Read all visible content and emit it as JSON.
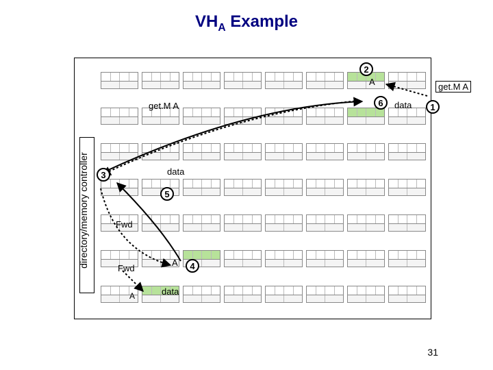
{
  "title_main": "VH",
  "title_sub": "A",
  "title_tail": " Example",
  "sidebar_label": "directory/memory controller",
  "labels": {
    "getM_A_top": "get.M A",
    "getM_A_right": "get.M A",
    "data1": "data",
    "data2": "data",
    "data3": "data",
    "fwd1": "Fwd",
    "fwd2": "Fwd",
    "A1": "A",
    "A2": "A",
    "A3": "A"
  },
  "steps": {
    "s1": "1",
    "s2": "2",
    "s3": "3",
    "s4": "4",
    "s5": "5",
    "s6": "6"
  },
  "page_number": "31",
  "chart_data": {
    "type": "diagram",
    "title": "VH_A Example",
    "grid": {
      "rows": 7,
      "cols": 8
    },
    "nodes": [
      {
        "row": 0,
        "col": 6,
        "state": "green",
        "label": "A"
      },
      {
        "row": 1,
        "col": 6,
        "state": "green"
      },
      {
        "row": 6,
        "col": 1,
        "state": "green",
        "label": "A"
      },
      {
        "row": 5,
        "col": 2,
        "state": "green",
        "label": "A"
      }
    ],
    "external_node": {
      "label": "get.M A",
      "position": "right-of-grid"
    },
    "steps": [
      {
        "n": 1,
        "label": "get.M A",
        "from": "external",
        "to": {
          "row": 0,
          "col": 6
        }
      },
      {
        "n": 2,
        "label": "A",
        "at": {
          "row": 0,
          "col": 6
        }
      },
      {
        "n": 3,
        "label": "get.M A",
        "from": {
          "row": 0,
          "col": 6
        },
        "to": "directory-left"
      },
      {
        "n": 4,
        "label": "Fwd",
        "from": "directory-left",
        "to": {
          "row": 5,
          "col": 2
        }
      },
      {
        "n": 5,
        "label": "data",
        "from": {
          "row": 5,
          "col": 2
        },
        "to": "directory-left"
      },
      {
        "n": 6,
        "label": "data",
        "from": "directory-left",
        "to": {
          "row": 0,
          "col": 6
        }
      }
    ]
  }
}
